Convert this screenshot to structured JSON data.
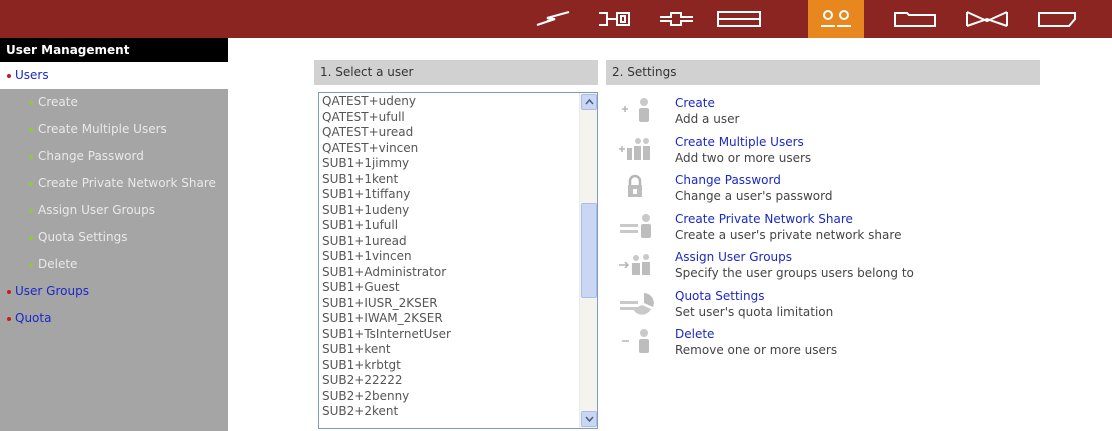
{
  "topbar": {
    "icons": [
      "lightning-icon",
      "network-icon",
      "device-icon",
      "storage-icon",
      "users-icon",
      "folder-icon",
      "envelope-icon",
      "tag-icon"
    ],
    "active_index": 4,
    "colors": {
      "bar": "#8b2521",
      "active": "#e8871d"
    }
  },
  "sidebar": {
    "title": "User Management",
    "items": [
      {
        "label": "Users",
        "level": "top",
        "selected": true
      },
      {
        "label": "Create",
        "level": "sub"
      },
      {
        "label": "Create Multiple Users",
        "level": "sub"
      },
      {
        "label": "Change Password",
        "level": "sub"
      },
      {
        "label": "Create Private Network Share",
        "level": "sub"
      },
      {
        "label": "Assign User Groups",
        "level": "sub"
      },
      {
        "label": "Quota Settings",
        "level": "sub"
      },
      {
        "label": "Delete",
        "level": "sub"
      },
      {
        "label": "User Groups",
        "level": "top"
      },
      {
        "label": "Quota",
        "level": "top"
      }
    ]
  },
  "select_user": {
    "heading": "1. Select a user",
    "users": [
      "QATEST+udeny",
      "QATEST+ufull",
      "QATEST+uread",
      "QATEST+vincen",
      "SUB1+1jimmy",
      "SUB1+1kent",
      "SUB1+1tiffany",
      "SUB1+1udeny",
      "SUB1+1ufull",
      "SUB1+1uread",
      "SUB1+1vincen",
      "SUB1+Administrator",
      "SUB1+Guest",
      "SUB1+IUSR_2KSER",
      "SUB1+IWAM_2KSER",
      "SUB1+TsInternetUser",
      "SUB1+kent",
      "SUB1+krbtgt",
      "SUB2+22222",
      "SUB2+2benny",
      "SUB2+2kent"
    ]
  },
  "settings": {
    "heading": "2. Settings",
    "items": [
      {
        "title": "Create",
        "description": "Add a user",
        "icon": "add-user-icon"
      },
      {
        "title": "Create Multiple Users",
        "description": "Add two or more users",
        "icon": "add-multiple-users-icon"
      },
      {
        "title": "Change Password",
        "description": "Change a user's password",
        "icon": "lock-icon"
      },
      {
        "title": "Create Private Network Share",
        "description": "Create a user's private network share",
        "icon": "network-share-icon"
      },
      {
        "title": "Assign User Groups",
        "description": "Specify the user groups users belong to",
        "icon": "user-groups-icon"
      },
      {
        "title": "Quota Settings",
        "description": "Set user's quota limitation",
        "icon": "quota-icon"
      },
      {
        "title": "Delete",
        "description": "Remove one or more users",
        "icon": "remove-user-icon"
      }
    ]
  }
}
